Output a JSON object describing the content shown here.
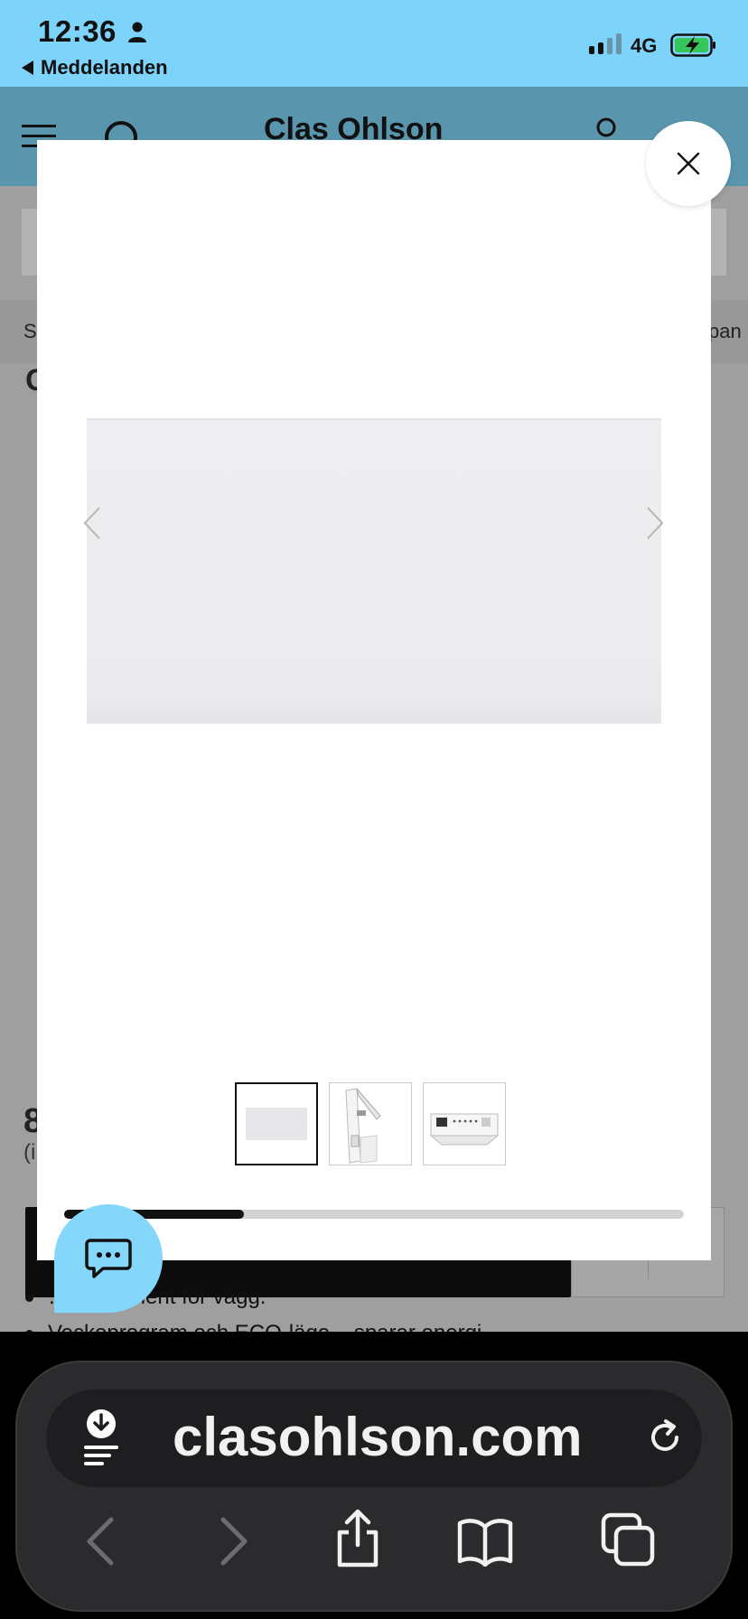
{
  "status_bar": {
    "time": "12:36",
    "back_label": "Meddelanden",
    "network": "4G"
  },
  "background_page": {
    "logo": "Clas Ohlson",
    "breadcrumb_left": "S",
    "breadcrumb_right": "pan",
    "title_fragment": "C",
    "price_fragment": "8",
    "price_sub_fragment": "(i",
    "bullets": [
      "…nelelement för vägg.",
      "Veckoprogram och ECO-läge – sparar energi"
    ]
  },
  "modal": {
    "image_index": 1,
    "image_count": 3,
    "scroll_progress": 0.29
  },
  "browser": {
    "url": "clasohlson.com"
  },
  "colors": {
    "status_bar_bg": "#7dd3fa",
    "chat_button_bg": "#84d6fb",
    "header_dim": "#5a95ae"
  }
}
